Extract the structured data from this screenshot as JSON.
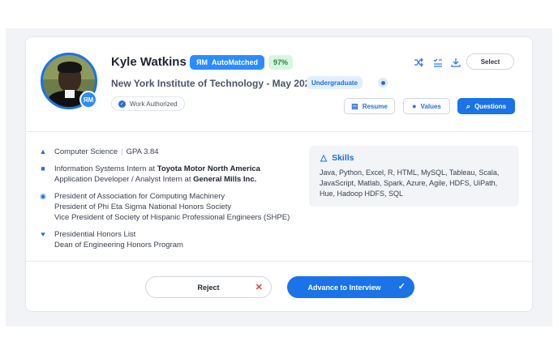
{
  "candidate": {
    "initials_badge": "ЯM",
    "name": "Kyle Watkins",
    "automatched_label": "AutoMatched",
    "automatched_logo": "ЯM",
    "match_score": "97%",
    "school": "New York Institute of Technology - May 2021",
    "level": "Undergraduate",
    "work_status": "Work Authorized"
  },
  "toolbar": {
    "icons": [
      "shuffle-icon",
      "list-check-icon",
      "download-icon"
    ],
    "select_label": "Select"
  },
  "actions": {
    "resume": "Resume",
    "values": "Values",
    "questions": "Questions"
  },
  "details": {
    "major": "Computer Science",
    "gpa": "GPA 3.84",
    "exp1_prefix": "Information Systems Intern at ",
    "exp1_company": "Toyota Motor North America",
    "exp2_prefix": "Application Developer / Analyst Intern at ",
    "exp2_company": "General Mills Inc.",
    "org1": "President of Association for Computing Machinery",
    "org2": "President of Phi Eta Sigma National Honors Society",
    "org3": "Vice President of Society of Hispanic Professional Engineers (SHPE)",
    "honor1": "Presidential Honors List",
    "honor2": "Dean of Engineering Honors Program"
  },
  "skills": {
    "title": "Skills",
    "list": "Java, Python, Excel, R, HTML, MySQL, Tableau, Scala, JavaScript, Matlab, Spark, Azure, Agile, HDFS, UiPath, Hue, Hadoop HDFS, SQL"
  },
  "footer": {
    "reject": "Reject",
    "advance": "Advance to Interview"
  },
  "colors": {
    "accent": "#1a73e8",
    "score_bg": "#d8f5e0",
    "reject_x": "#e53935"
  }
}
